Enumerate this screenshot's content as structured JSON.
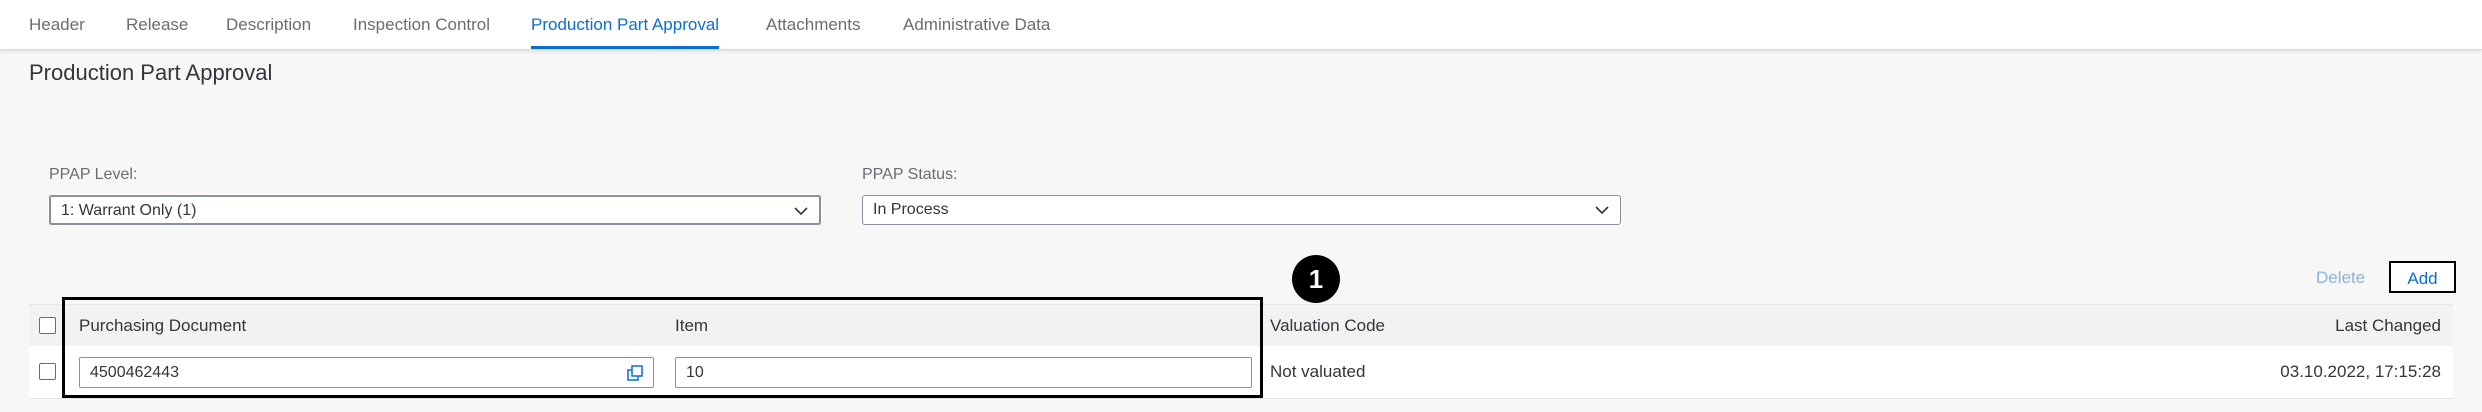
{
  "tabs": [
    {
      "label": "Header",
      "active": false
    },
    {
      "label": "Release",
      "active": false
    },
    {
      "label": "Description",
      "active": false
    },
    {
      "label": "Inspection Control",
      "active": false
    },
    {
      "label": "Production Part Approval",
      "active": true
    },
    {
      "label": "Attachments",
      "active": false
    },
    {
      "label": "Administrative Data",
      "active": false
    }
  ],
  "section": {
    "title": "Production Part Approval"
  },
  "ppap_level": {
    "label": "PPAP Level:",
    "value": "1: Warrant Only (1)",
    "icon": "chevron-down-icon"
  },
  "ppap_status": {
    "label": "PPAP Status:",
    "value": "In Process",
    "icon": "chevron-down-icon"
  },
  "toolbar": {
    "delete_label": "Delete",
    "add_label": "Add"
  },
  "callout": {
    "number": "1"
  },
  "table": {
    "columns": {
      "purchasing_document": "Purchasing Document",
      "item": "Item",
      "valuation_code": "Valuation Code",
      "last_changed": "Last Changed"
    },
    "rows": [
      {
        "purchasing_document": "4500462443",
        "item": "10",
        "valuation_code": "Not valuated",
        "last_changed": "03.10.2022, 17:15:28"
      }
    ]
  },
  "colors": {
    "accent": "#0a6ed1",
    "disabled_link": "#8fb2d9",
    "text": "#32363a",
    "muted": "#6a6d70"
  }
}
